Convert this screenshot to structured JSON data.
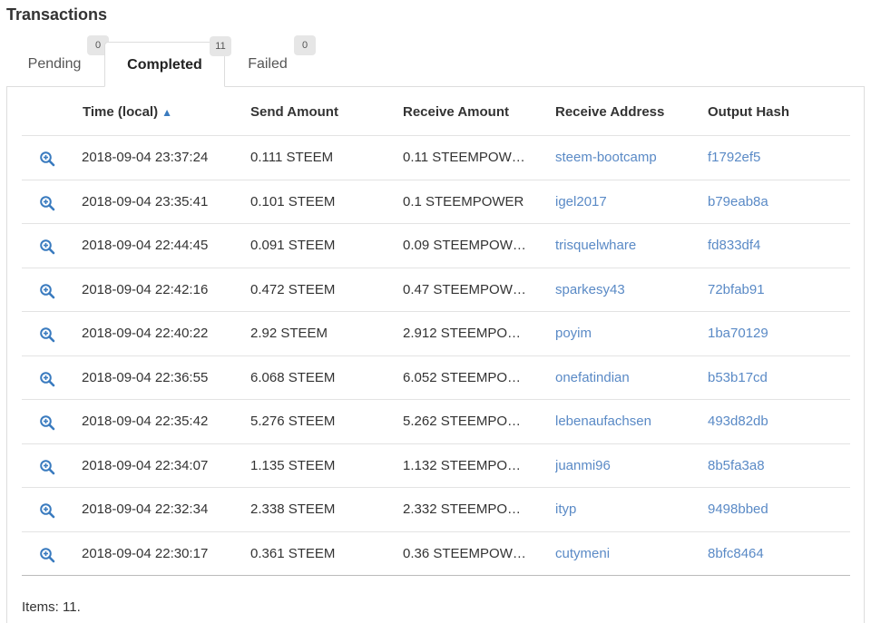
{
  "page": {
    "title": "Transactions"
  },
  "tabs": [
    {
      "label": "Pending",
      "count": "0",
      "active": false
    },
    {
      "label": "Completed",
      "count": "11",
      "active": true
    },
    {
      "label": "Failed",
      "count": "0",
      "active": false
    }
  ],
  "table": {
    "columns": {
      "time": "Time (local)",
      "sort_indicator": "▲",
      "send": "Send Amount",
      "receive": "Receive Amount",
      "address": "Receive Address",
      "hash": "Output Hash"
    },
    "rows": [
      {
        "time": "2018-09-04 23:37:24",
        "send": "0.111 STEEM",
        "receive": "0.11 STEEMPOW…",
        "address": "steem-bootcamp",
        "hash": "f1792ef5"
      },
      {
        "time": "2018-09-04 23:35:41",
        "send": "0.101 STEEM",
        "receive": "0.1 STEEMPOWER",
        "address": "igel2017",
        "hash": "b79eab8a"
      },
      {
        "time": "2018-09-04 22:44:45",
        "send": "0.091 STEEM",
        "receive": "0.09 STEEMPOW…",
        "address": "trisquelwhare",
        "hash": "fd833df4"
      },
      {
        "time": "2018-09-04 22:42:16",
        "send": "0.472 STEEM",
        "receive": "0.47 STEEMPOW…",
        "address": "sparkesy43",
        "hash": "72bfab91"
      },
      {
        "time": "2018-09-04 22:40:22",
        "send": "2.92 STEEM",
        "receive": "2.912 STEEMPO…",
        "address": "poyim",
        "hash": "1ba70129"
      },
      {
        "time": "2018-09-04 22:36:55",
        "send": "6.068 STEEM",
        "receive": "6.052 STEEMPO…",
        "address": "onefatindian",
        "hash": "b53b17cd"
      },
      {
        "time": "2018-09-04 22:35:42",
        "send": "5.276 STEEM",
        "receive": "5.262 STEEMPO…",
        "address": "lebenaufachsen",
        "hash": "493d82db"
      },
      {
        "time": "2018-09-04 22:34:07",
        "send": "1.135 STEEM",
        "receive": "1.132 STEEMPO…",
        "address": "juanmi96",
        "hash": "8b5fa3a8"
      },
      {
        "time": "2018-09-04 22:32:34",
        "send": "2.338 STEEM",
        "receive": "2.332 STEEMPO…",
        "address": "ityp",
        "hash": "9498bbed"
      },
      {
        "time": "2018-09-04 22:30:17",
        "send": "0.361 STEEM",
        "receive": "0.36 STEEMPOW…",
        "address": "cutymeni",
        "hash": "8bfc8464"
      }
    ],
    "row_icon": "zoom-in-icon"
  },
  "footer": {
    "items_text": "Items: 11."
  },
  "colors": {
    "link": "#5a8ac6",
    "icon": "#3a7bbf",
    "badge_bg": "#e6e6e6",
    "border": "#dddddd"
  }
}
